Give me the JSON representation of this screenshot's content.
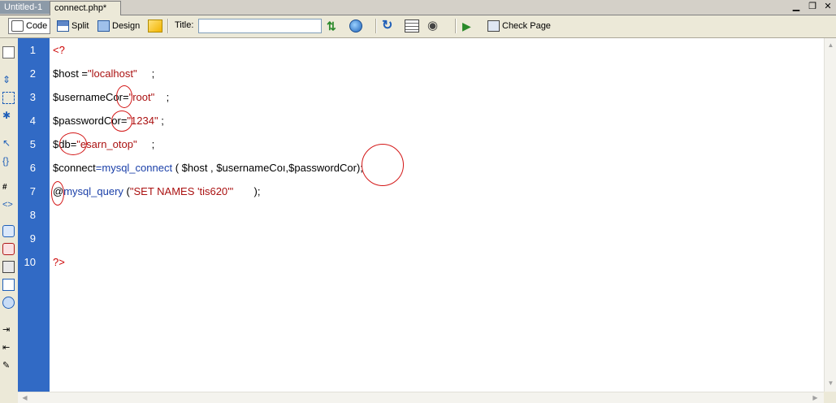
{
  "tabs": [
    {
      "label": "Untitled-1",
      "active": false
    },
    {
      "label": "connect.php*",
      "active": true
    }
  ],
  "toolbar": {
    "code_label": "Code",
    "split_label": "Split",
    "design_label": "Design",
    "title_label": "Title:",
    "title_value": "",
    "check_page_label": "Check Page"
  },
  "editor": {
    "line_numbers": [
      "1",
      "2",
      "3",
      "4",
      "5",
      "6",
      "7",
      "8",
      "9",
      "10"
    ],
    "lines": {
      "l1_open": "<?",
      "l2_var": "$host",
      "l2_eq": " =",
      "l2_str": "\"localhost\"",
      "l2_end": "     ;",
      "l3_var": "$usernameCor",
      "l3_eq": "=",
      "l3_str": "\"root\"",
      "l3_end": "    ;",
      "l4_var": "$passwordCor",
      "l4_eq": "=",
      "l4_str": "\"1234\"",
      "l4_end": " ;",
      "l5_var": "$db",
      "l5_eq": "=",
      "l5_str": "\"esarn_otop\"",
      "l5_end": "     ;",
      "l6_var": "$connect",
      "l6_eq": "=",
      "l6_fn": "mysql_connect",
      "l6_args": " ( $host , $usernameCoı,$passwordCor);",
      "l7_at": "@",
      "l7_fn": "mysql_query",
      "l7_open": " (",
      "l7_str": "\"SET NAMES 'tis620'\"",
      "l7_end": "       );",
      "l10_close": "?>"
    }
  },
  "colors": {
    "gutter": "#316ac5",
    "php_tag": "#cc0000",
    "string": "#aa1111",
    "function": "#1a3fa8",
    "annotation_circle": "#d31616"
  }
}
